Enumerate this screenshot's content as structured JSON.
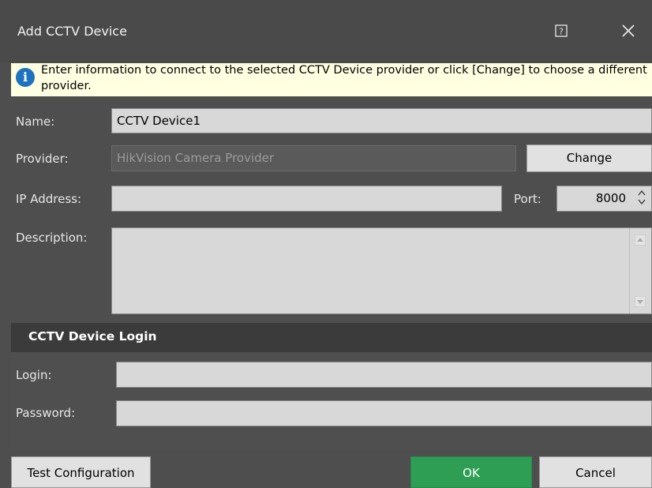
{
  "window": {
    "title": "Add CCTV Device"
  },
  "info": {
    "message": "Enter information to connect to the selected CCTV Device provider or click [Change] to choose a different provider."
  },
  "form": {
    "name_label": "Name:",
    "name_value": "CCTV Device1",
    "provider_label": "Provider:",
    "provider_value": "HikVision Camera Provider",
    "change_label": "Change",
    "ip_label": "IP Address:",
    "ip_value": "",
    "port_label": "Port:",
    "port_value": "8000",
    "description_label": "Description:",
    "description_value": ""
  },
  "login_section": {
    "title": "CCTV Device Login",
    "login_label": "Login:",
    "login_value": "",
    "password_label": "Password:",
    "password_value": ""
  },
  "buttons": {
    "test": "Test Configuration",
    "ok": "OK",
    "cancel": "Cancel"
  },
  "colors": {
    "ok_button": "#2f9e55",
    "info_background": "#ffffe1",
    "dialog_background": "#4e4e4e"
  }
}
